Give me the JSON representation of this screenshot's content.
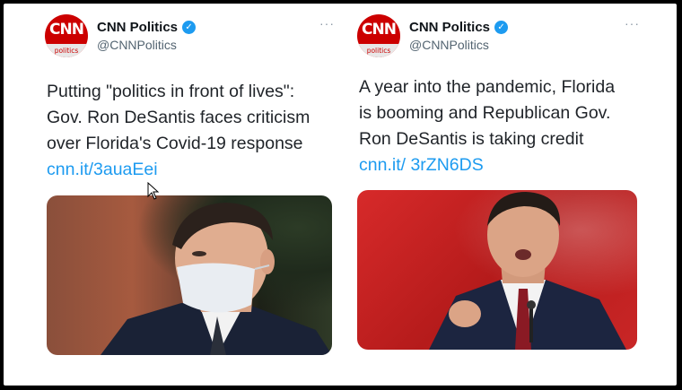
{
  "tweets": [
    {
      "avatar": {
        "brand": "CNN",
        "sub": "politics",
        "color": "#cc0000"
      },
      "name": "CNN Politics",
      "handle": "@CNNPolitics",
      "more": "···",
      "text": "Putting \"politics in front of lives\": Gov. Ron DeSantis faces criticism over Florida's Covid-19 response ",
      "link": "cnn.it/3auaEei"
    },
    {
      "avatar": {
        "brand": "CNN",
        "sub": "politics",
        "color": "#cc0000"
      },
      "name": "CNN Politics",
      "handle": "@CNNPolitics",
      "more": "···",
      "text": "A year into the pandemic, Florida is booming and Republican Gov. Ron DeSantis is taking credit ",
      "link": "cnn.it/ 3rZN6DS"
    }
  ],
  "colors": {
    "verified": "#1d9bf0",
    "link": "#1d9bf0",
    "brand_red": "#cc0000"
  },
  "icons": {
    "verified": "verified-badge-icon",
    "more": "more-options-icon",
    "cursor": "mouse-pointer-icon"
  }
}
